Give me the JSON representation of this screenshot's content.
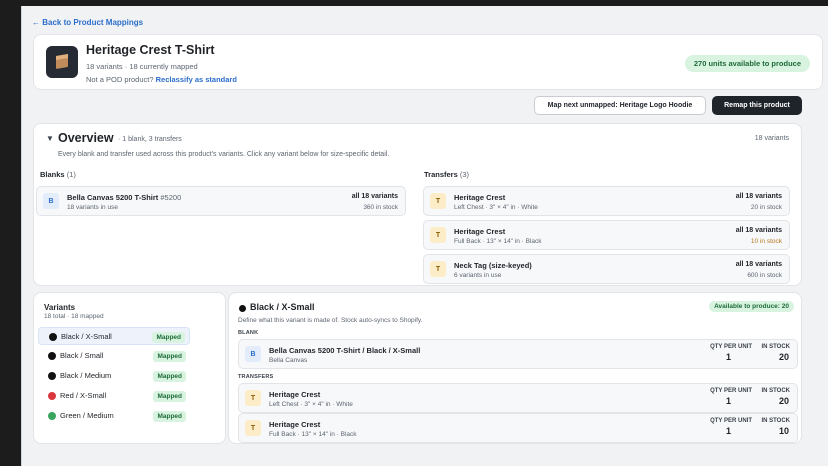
{
  "back_link": "← Back to Product Mappings",
  "product": {
    "title": "Heritage Crest T-Shirt",
    "subtitle": "18 variants · 18 currently mapped",
    "pod_question": "Not a POD product?",
    "reclassify_link": "Reclassify as standard",
    "units_badge": "270 units available to produce"
  },
  "actions": {
    "map_next": "Map next unmapped: Heritage Logo Hoodie",
    "remap": "Remap this product"
  },
  "overview": {
    "title": "Overview",
    "meta": "· 1 blank, 3 transfers",
    "count": "18 variants",
    "description": "Every blank and transfer used across this product's variants. Click any variant below for size-specific detail.",
    "blanks_label": "Blanks",
    "blanks_count": "(1)",
    "transfers_label": "Transfers",
    "transfers_count": "(3)",
    "blanks": [
      {
        "icon": "B",
        "name": "Bella Canvas 5200 T-Shirt",
        "sku": "#5200",
        "sub": "18 variants in use",
        "coverage": "all 18 variants",
        "stock": "360 in stock"
      }
    ],
    "transfers": [
      {
        "icon": "T",
        "name": "Heritage Crest",
        "sub": "Left Chest · 3\" × 4\" in · White",
        "coverage": "all 18 variants",
        "stock": "20 in stock",
        "low": false
      },
      {
        "icon": "T",
        "name": "Heritage Crest",
        "sub": "Full Back · 13\" × 14\" in · Black",
        "coverage": "all 18 variants",
        "stock": "10 in stock",
        "low": true
      },
      {
        "icon": "T",
        "name": "Neck Tag (size-keyed)",
        "sub": "6 variants in use",
        "coverage": "all 18 variants",
        "stock": "600 in stock",
        "low": false
      }
    ]
  },
  "variants": {
    "title": "Variants",
    "subtitle": "18 total · 18 mapped",
    "items": [
      {
        "label": "Black / X-Small",
        "color": "#111111",
        "badge": "Mapped",
        "active": true
      },
      {
        "label": "Black / Small",
        "color": "#111111",
        "badge": "Mapped",
        "active": false
      },
      {
        "label": "Black / Medium",
        "color": "#111111",
        "badge": "Mapped",
        "active": false
      },
      {
        "label": "Red / X-Small",
        "color": "#d9363e",
        "badge": "Mapped",
        "active": false
      },
      {
        "label": "Green / Medium",
        "color": "#3aa55d",
        "badge": "Mapped",
        "active": false
      }
    ]
  },
  "detail": {
    "title": "Black / X-Small",
    "subtitle": "Define what this variant is made of. Stock auto-syncs to Shopify.",
    "badge": "Available to produce: 20",
    "blank_label": "BLANK",
    "transfers_label": "TRANSFERS",
    "qty_header": "QTY PER UNIT",
    "stock_header": "IN STOCK",
    "blank": {
      "icon": "B",
      "name": "Bella Canvas 5200 T-Shirt / Black / X-Small",
      "sub": "Bella Canvas",
      "qty": "1",
      "stock": "20"
    },
    "transfers": [
      {
        "icon": "T",
        "name": "Heritage Crest",
        "sub": "Left Chest · 3\" × 4\" in · White",
        "qty": "1",
        "stock": "20"
      },
      {
        "icon": "T",
        "name": "Heritage Crest",
        "sub": "Full Back · 13\" × 14\" in · Black",
        "qty": "1",
        "stock": "10"
      }
    ]
  },
  "colors": {
    "accent": "#2c6ecb",
    "success_bg": "#d8f3df",
    "success_text": "#1d6b38",
    "warn": "#b7791f",
    "dark_button": "#1f242b"
  }
}
